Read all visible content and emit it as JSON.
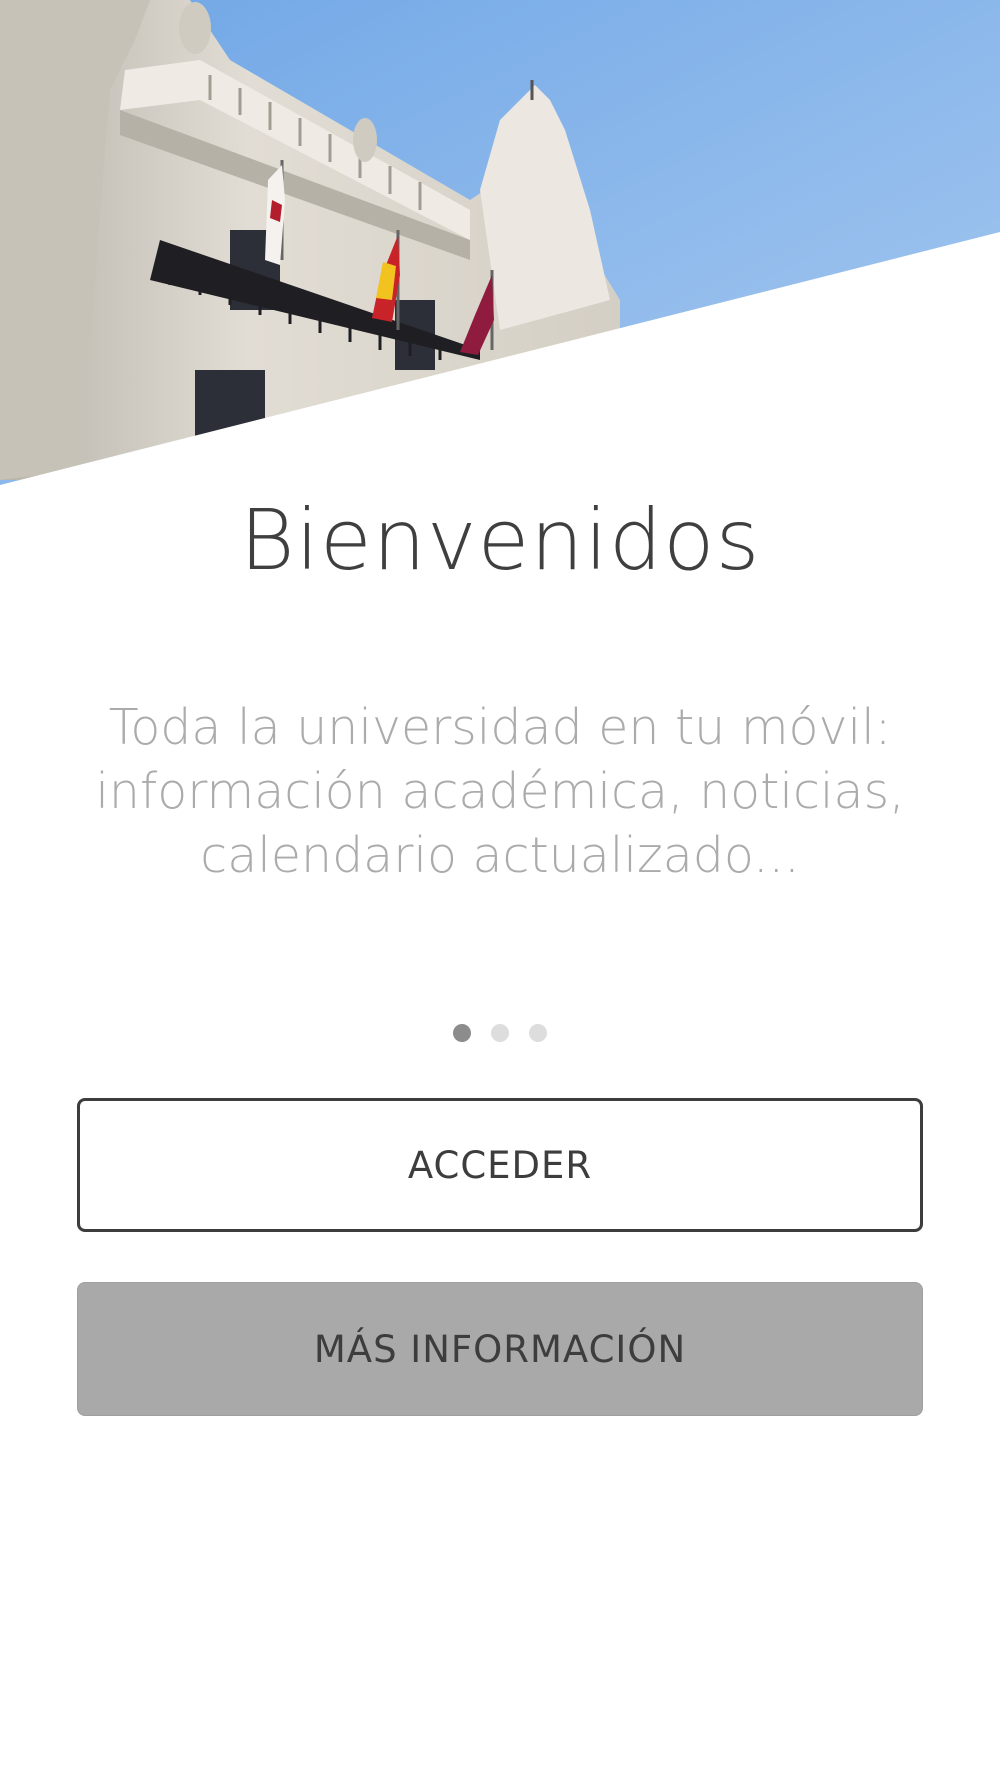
{
  "welcome": {
    "title": "Bienvenidos",
    "subtitle": "Toda la universidad en tu móvil: información académica, noticias, calendario actualizado..."
  },
  "pager": {
    "pages": 3,
    "active_index": 0
  },
  "actions": {
    "login_label": "ACCEDER",
    "more_info_label": "MÁS INFORMACIÓN"
  },
  "colors": {
    "sky": "#7fb0e8",
    "stone": "#d9d4ca",
    "title_text": "#3f3f3f",
    "subtitle_text": "#ababab",
    "button_fill": "#a9a9a9",
    "dot_active": "#8c8c8c",
    "dot_inactive": "#dddddd"
  },
  "hero_image": {
    "icon": "university-building-photo"
  }
}
